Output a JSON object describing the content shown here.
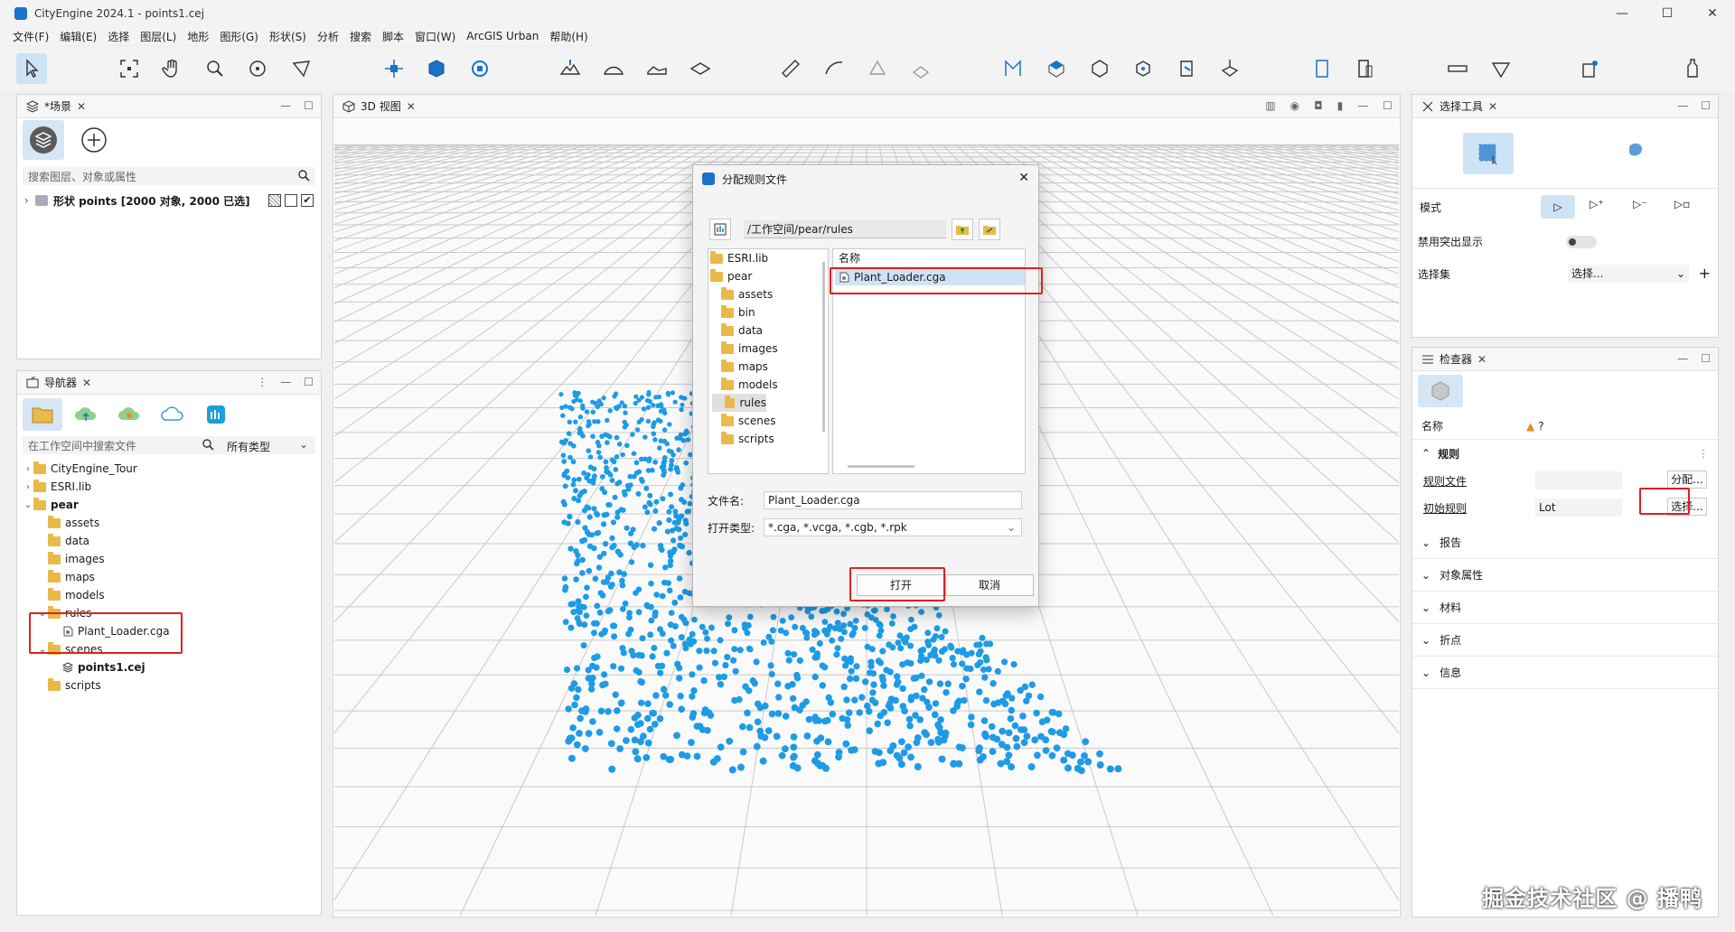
{
  "window": {
    "title": "CityEngine 2024.1 - points1.cej",
    "min": "—",
    "max": "☐",
    "close": "✕"
  },
  "menu": [
    "文件(F)",
    "编辑(E)",
    "选择",
    "图层(L)",
    "地形",
    "图形(G)",
    "形状(S)",
    "分析",
    "搜索",
    "脚本",
    "窗口(W)",
    "ArcGIS Urban",
    "帮助(H)"
  ],
  "toolbar_icons": [
    "select-arrow-icon",
    "frame-icon",
    "pan-hand-icon",
    "zoom-icon",
    "orbit-icon",
    "lasso-icon",
    "move-icon",
    "scale-cube-icon",
    "rotate-icon",
    "terrain-raise-icon",
    "terrain-smooth-icon",
    "terrain-flatten-icon",
    "terrain-level-icon",
    "measure-line-icon",
    "measure-arc-icon",
    "measure-area-icon",
    "measure-height-icon",
    "polygon-draw-icon",
    "extrude-icon",
    "rectangle-shape-icon",
    "circle-shape-icon",
    "street-shape-icon",
    "street-network-icon",
    "building-tool-icon",
    "building-facade-icon",
    "ruler-icon",
    "angle-icon",
    "model-export-icon",
    "bottle-icon"
  ],
  "scene_panel": {
    "title": "*场景",
    "close": "✕",
    "search_placeholder": "搜索图层、对象或属性",
    "layer_label": "形状 points [2000 对象, 2000 已选]",
    "check_mark": "✔"
  },
  "navigator": {
    "title": "导航器",
    "close": "✕",
    "search_placeholder": "在工作空间中搜索文件",
    "type_filter": "所有类型",
    "tree": [
      {
        "label": "CityEngine_Tour",
        "level": 0,
        "chev": "›",
        "bold": false
      },
      {
        "label": "ESRI.lib",
        "level": 0,
        "chev": "›",
        "bold": false
      },
      {
        "label": "pear",
        "level": 0,
        "chev": "⌄",
        "bold": true
      },
      {
        "label": "assets",
        "level": 1,
        "chev": "",
        "bold": false
      },
      {
        "label": "data",
        "level": 1,
        "chev": "",
        "bold": false
      },
      {
        "label": "images",
        "level": 1,
        "chev": "",
        "bold": false
      },
      {
        "label": "maps",
        "level": 1,
        "chev": "",
        "bold": false
      },
      {
        "label": "models",
        "level": 1,
        "chev": "",
        "bold": false
      },
      {
        "label": "rules",
        "level": 1,
        "chev": "⌄",
        "bold": false
      },
      {
        "label": "Plant_Loader.cga",
        "level": 2,
        "chev": "",
        "bold": false,
        "file": true
      },
      {
        "label": "scenes",
        "level": 1,
        "chev": "⌄",
        "bold": false
      },
      {
        "label": "points1.cej",
        "level": 2,
        "chev": "",
        "bold": true,
        "scene": true
      },
      {
        "label": "scripts",
        "level": 1,
        "chev": "",
        "bold": false
      }
    ]
  },
  "viewport": {
    "title": "3D 视图",
    "close": "✕"
  },
  "dialog": {
    "title": "分配规则文件",
    "close": "✕",
    "path": "/工作空间/pear/rules",
    "dir_tree": [
      {
        "label": "ESRI.lib",
        "level": 0
      },
      {
        "label": "pear",
        "level": 0
      },
      {
        "label": "assets",
        "level": 1
      },
      {
        "label": "bin",
        "level": 1
      },
      {
        "label": "data",
        "level": 1
      },
      {
        "label": "images",
        "level": 1
      },
      {
        "label": "maps",
        "level": 1
      },
      {
        "label": "models",
        "level": 1
      },
      {
        "label": "rules",
        "level": 1,
        "selected": true
      },
      {
        "label": "scenes",
        "level": 1
      },
      {
        "label": "scripts",
        "level": 1
      }
    ],
    "list_header": "名称",
    "selected_file": "Plant_Loader.cga",
    "filename_label": "文件名:",
    "filename_value": "Plant_Loader.cga",
    "filetype_label": "打开类型:",
    "filetype_value": "*.cga, *.vcga, *.cgb, *.rpk",
    "open_button": "打开",
    "cancel_button": "取消"
  },
  "select_tool": {
    "title": "选择工具",
    "close": "✕",
    "mode_label": "模式",
    "highlight_label": "禁用突出显示",
    "selection_set_label": "选择集",
    "selection_set_value": "选择...",
    "add": "+"
  },
  "inspector": {
    "title": "检查器",
    "close": "✕",
    "name_label": "名称",
    "name_value": "?",
    "rules_section": "规则",
    "rule_file_label": "规则文件",
    "assign_button": "分配...",
    "start_rule_label": "初始规则",
    "start_rule_value": "Lot",
    "choose_button": "选择...",
    "sections": [
      "报告",
      "对象属性",
      "材料",
      "折点",
      "信息"
    ]
  },
  "watermark": "掘金技术社区 @ 播鸭",
  "colors": {
    "accent": "#1a73c8",
    "points": "#1e9be6",
    "highlight": "#e02020",
    "selection": "#cfe3f6"
  }
}
